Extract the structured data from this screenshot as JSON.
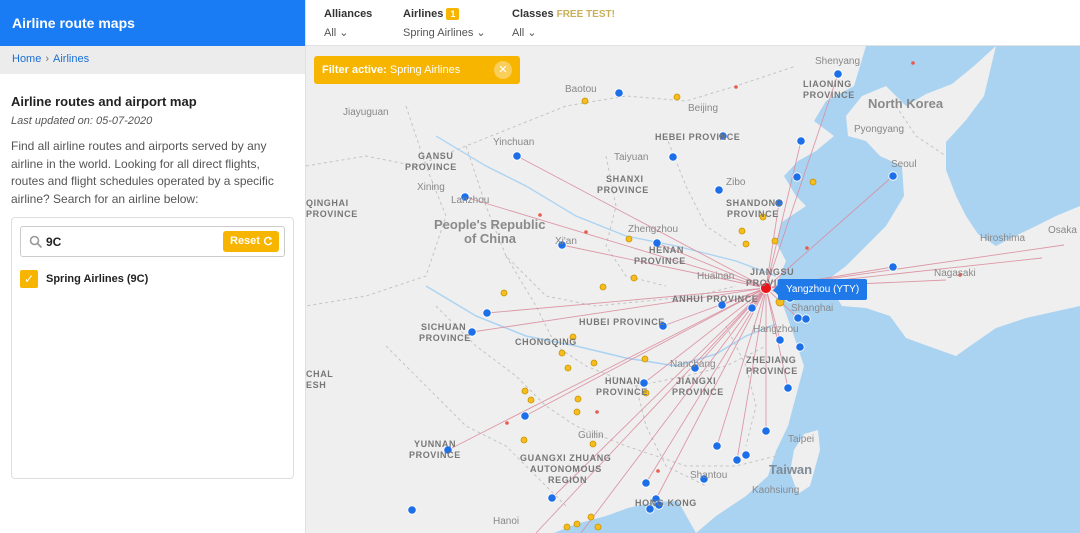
{
  "sidebar": {
    "brand": "Airline route maps",
    "breadcrumb": {
      "home": "Home",
      "separator": "›",
      "current": "Airlines"
    },
    "title": "Airline routes and airport map",
    "updated": "Last updated on: 05-07-2020",
    "description": "Find all airline routes and airports served by any airline in the world. Looking for all direct flights, routes and flight schedules operated by a specific airline? Search for an airline below:",
    "search": {
      "value": "9C",
      "reset_label": "Reset"
    },
    "airline_option": {
      "label": "Spring Airlines (9C)",
      "checked": true
    }
  },
  "topbar": {
    "alliances": {
      "title": "Alliances",
      "value": "All"
    },
    "airlines": {
      "title": "Airlines",
      "badge": "1",
      "value": "Spring Airlines"
    },
    "classes": {
      "title": "Classes",
      "tag": "FREE TEST!",
      "value": "All"
    }
  },
  "map": {
    "filter_chip": {
      "prefix": "Filter active:",
      "value": "Spring Airlines"
    },
    "tooltip": "Yangzhou (YTY)",
    "labels": {
      "shenyang": "Shenyang",
      "liaoning": "LIAONING",
      "liaoning2": "PROVINCE",
      "north_korea": "North Korea",
      "pyongyang": "Pyongyang",
      "seoul": "Seoul",
      "hiroshima": "Hiroshima",
      "osaka": "Osaka",
      "nagasaki": "Nagasaki",
      "baotou": "Baotou",
      "beijing": "Beijing",
      "jiayuguan": "Jiayuguan",
      "yinchuan": "Yinchuan",
      "hebei": "HEBEI PROVINCE",
      "gansu": "GANSU",
      "gansu2": "PROVINCE",
      "taiyuan": "Taiyuan",
      "xining": "Xining",
      "shanxi": "SHANXI",
      "shanxi2": "PROVINCE",
      "zibo": "Zibo",
      "shandong": "SHANDONG",
      "shandong2": "PROVINCE",
      "qinghai": "QINGHAI",
      "qinghai2": "PROVINCE",
      "lanzhou": "Lanzhou",
      "prc1": "People's Republic",
      "prc2": "of China",
      "zhengzhou": "Zhengzhou",
      "henan": "HENAN",
      "henan2": "PROVINCE",
      "xian": "Xi'an",
      "huainan": "Huainan",
      "jiangsu": "JIANGSU",
      "jiangsu2": "PROVINCE",
      "anhui": "ANHUI PROVINCE",
      "shanghai": "Shanghai",
      "sichuan": "SICHUAN",
      "sichuan2": "PROVINCE",
      "hubei": "HUBEI PROVINCE",
      "hangzhou": "Hangzhou",
      "chongqing": "CHONGQING",
      "zhejiang": "ZHEJIANG",
      "zhejiang2": "PROVINCE",
      "nanchang": "Nanchang",
      "tibet": "CHAL",
      "tibet2": "ESH",
      "hunan": "HUNAN",
      "hunan2": "PROVINCE",
      "jiangxi": "JIANGXI",
      "jiangxi2": "PROVINCE",
      "yunnan": "YUNNAN",
      "yunnan2": "PROVINCE",
      "guilin": "Guilin",
      "taipei": "Taipei",
      "guangxi": "GUANGXI ZHUANG",
      "guangxi2": "AUTONOMOUS",
      "guangxi3": "REGION",
      "taiwan": "Taiwan",
      "shantou": "Shantou",
      "kaohsiung": "Kaohsiung",
      "hongkong": "HONG KONG",
      "hanoi": "Hanoi"
    },
    "colors": {
      "hub": "#e8151b",
      "blue": "#1c6fe8",
      "yellow": "#f5bd1d",
      "route": "#d98a9c",
      "water": "#aad3f2",
      "land": "#efefef"
    }
  }
}
